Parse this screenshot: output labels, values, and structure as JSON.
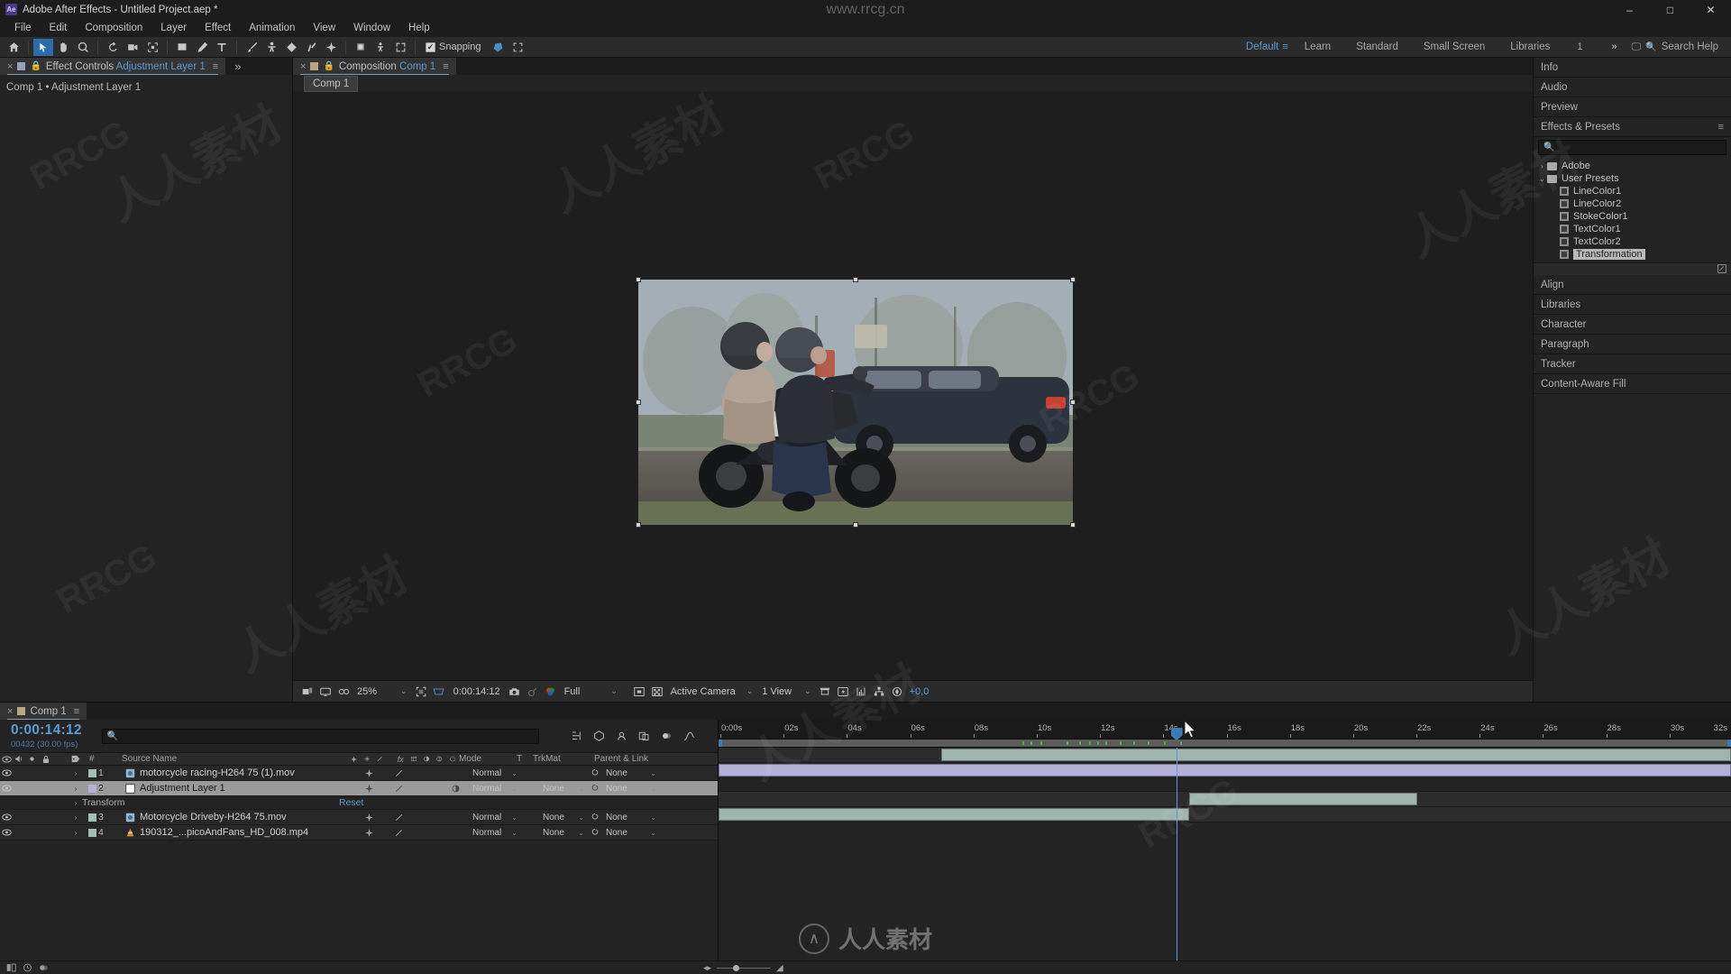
{
  "titlebar": {
    "app_icon": "ae-logo",
    "title": "Adobe After Effects - Untitled Project.aep *",
    "minimize": "–",
    "maximize": "□",
    "close": "✕"
  },
  "menubar": {
    "items": [
      "File",
      "Edit",
      "Composition",
      "Layer",
      "Effect",
      "Animation",
      "View",
      "Window",
      "Help"
    ]
  },
  "toolbar": {
    "snapping_label": "Snapping",
    "snapping_checked": true,
    "workspaces": [
      "Default",
      "Learn",
      "Standard",
      "Small Screen",
      "Libraries"
    ],
    "selected_workspace": "Default",
    "workspace_count": "1",
    "overflow": "»",
    "search_help": "Search Help"
  },
  "effect_controls": {
    "tab_prefix": "Effect Controls",
    "tab_target": "Adjustment Layer 1",
    "breadcrumb": "Comp 1 • Adjustment Layer 1",
    "expand": "»"
  },
  "composition": {
    "tab_prefix": "Composition",
    "tab_target": "Comp 1",
    "sub_tab": "Comp 1",
    "toolbar": {
      "zoom": "25%",
      "time": "0:00:14:12",
      "resolution": "Full",
      "camera": "Active Camera",
      "views": "1 View",
      "exposure": "+0,0"
    }
  },
  "right_panels": {
    "collapsed_top": [
      "Info",
      "Audio",
      "Preview"
    ],
    "effects_presets": {
      "title": "Effects & Presets",
      "search_placeholder": "",
      "tree": [
        {
          "label": "Adobe",
          "type": "folder",
          "expanded": false,
          "depth": 0
        },
        {
          "label": "User Presets",
          "type": "folder",
          "expanded": true,
          "depth": 0
        },
        {
          "label": "LineColor1",
          "type": "preset",
          "depth": 1
        },
        {
          "label": "LineColor2",
          "type": "preset",
          "depth": 1
        },
        {
          "label": "StokeColor1",
          "type": "preset",
          "depth": 1
        },
        {
          "label": "TextColor1",
          "type": "preset",
          "depth": 1
        },
        {
          "label": "TextColor2",
          "type": "preset",
          "depth": 1
        },
        {
          "label": "Transformation",
          "type": "preset",
          "depth": 1,
          "selected": true
        }
      ]
    },
    "collapsed_bottom": [
      "Align",
      "Libraries",
      "Character",
      "Paragraph",
      "Tracker",
      "Content-Aware Fill"
    ]
  },
  "timeline": {
    "tab_label": "Comp 1",
    "current_time": "0:00:14:12",
    "frame_info": "00432 (30.00 fps)",
    "search_placeholder": "",
    "columns": [
      "#",
      "Source Name",
      "Mode",
      "T",
      "TrkMat",
      "Parent & Link"
    ],
    "layers": [
      {
        "index": "1",
        "name": "motorcycle racing-H264 75 (1).mov",
        "mode": "Normal",
        "trkmat": "",
        "parent": "None",
        "swatch": "#9fc0b5",
        "icon": "video-icon",
        "bar": {
          "start_pct": 22.0,
          "end_pct": 100.0,
          "color": "green"
        },
        "selected": false
      },
      {
        "index": "2",
        "name": "Adjustment Layer 1",
        "mode": "Normal",
        "trkmat": "None",
        "parent": "None",
        "swatch": "#b4b0d8",
        "icon": "solid-icon",
        "bar": {
          "start_pct": 0.0,
          "end_pct": 100.0,
          "color": "purple"
        },
        "selected": true
      },
      {
        "index": "",
        "name": "Transform",
        "property": true,
        "reset": "Reset"
      },
      {
        "index": "3",
        "name": "Motorcycle Driveby-H264 75.mov",
        "mode": "Normal",
        "trkmat": "None",
        "parent": "None",
        "swatch": "#9fc0b5",
        "icon": "video-icon",
        "bar": {
          "start_pct": 46.5,
          "end_pct": 69.0,
          "color": "green"
        },
        "selected": false
      },
      {
        "index": "4",
        "name": "190312_...picoAndFans_HD_008.mp4",
        "mode": "Normal",
        "trkmat": "None",
        "parent": "None",
        "swatch": "#9fc0b5",
        "icon": "cone-icon",
        "bar": {
          "start_pct": 0.0,
          "end_pct": 46.5,
          "color": "green"
        },
        "selected": false
      }
    ],
    "ruler_ticks": [
      "0:00s",
      "02s",
      "04s",
      "06s",
      "08s",
      "10s",
      "12s",
      "14s",
      "16s",
      "18s",
      "20s",
      "22s",
      "24s",
      "26s",
      "28s",
      "30s",
      "32s"
    ],
    "playhead_pct": 45.2
  },
  "watermarks": {
    "top_url": "www.rrcg.cn",
    "center_text": "人人素材",
    "tile_text": "RRCG",
    "tile_cn": "人人素材"
  },
  "colors": {
    "accent_blue": "#5a9bd4",
    "panel_bg": "#232323",
    "titlebar_bg": "#1c1c1c",
    "toolbar_bg": "#2b2b2b",
    "layer_purple": "#b4b0d8",
    "layer_green": "#9fb5ae"
  }
}
